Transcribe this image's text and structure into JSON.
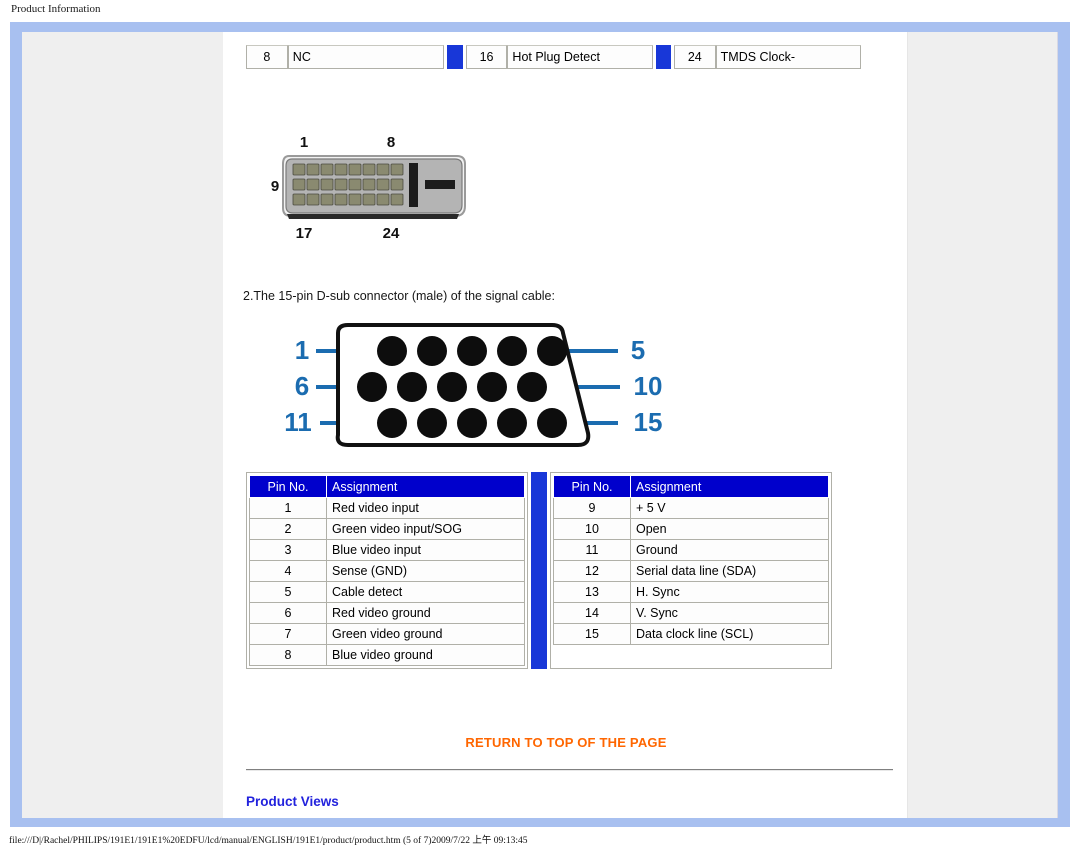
{
  "window": {
    "title": "Product Information"
  },
  "dvi_table": {
    "rows": [
      {
        "pin": "8",
        "assignment": "NC"
      },
      {
        "pin": "16",
        "assignment": "Hot Plug Detect"
      },
      {
        "pin": "24",
        "assignment": "TMDS Clock-"
      }
    ]
  },
  "dvi_connector": {
    "labels": {
      "top_left": "1",
      "top_right": "8",
      "left": "9",
      "bottom_left": "17",
      "bottom_right": "24"
    }
  },
  "section": {
    "heading": "2.The 15-pin D-sub connector (male) of the signal cable:"
  },
  "dsub_connector": {
    "labels": {
      "row1_left": "1",
      "row1_right": "5",
      "row2_left": "6",
      "row2_right": "10",
      "row3_left": "11",
      "row3_right": "15"
    },
    "accent_color": "#1b6cb0"
  },
  "pin_tables": {
    "headers": {
      "pin": "Pin No.",
      "assignment": "Assignment"
    },
    "header_bg": "#0000cc",
    "separator_color": "#1837d8",
    "left": [
      {
        "pin": "1",
        "assignment": "Red video input"
      },
      {
        "pin": "2",
        "assignment": "Green video input/SOG"
      },
      {
        "pin": "3",
        "assignment": "Blue video input"
      },
      {
        "pin": "4",
        "assignment": "Sense (GND)"
      },
      {
        "pin": "5",
        "assignment": "Cable detect"
      },
      {
        "pin": "6",
        "assignment": "Red video ground"
      },
      {
        "pin": "7",
        "assignment": "Green video ground"
      },
      {
        "pin": "8",
        "assignment": "Blue video ground"
      }
    ],
    "right": [
      {
        "pin": "9",
        "assignment": "+ 5 V"
      },
      {
        "pin": "10",
        "assignment": "Open"
      },
      {
        "pin": "11",
        "assignment": "Ground"
      },
      {
        "pin": "12",
        "assignment": "Serial data line (SDA)"
      },
      {
        "pin": "13",
        "assignment": "H. Sync"
      },
      {
        "pin": "14",
        "assignment": "V. Sync"
      },
      {
        "pin": "15",
        "assignment": "Data clock line (SCL)"
      }
    ]
  },
  "links": {
    "return_to_top": "RETURN TO TOP OF THE PAGE",
    "return_color": "#ff6600"
  },
  "product_views": {
    "heading": "Product Views",
    "color": "#2222dd"
  },
  "status": {
    "path": "file:///D|/Rachel/PHILIPS/191E1/191E1%20EDFU/lcd/manual/ENGLISH/191E1/product/product.htm (5 of 7)2009/7/22 上午 09:13:45"
  }
}
